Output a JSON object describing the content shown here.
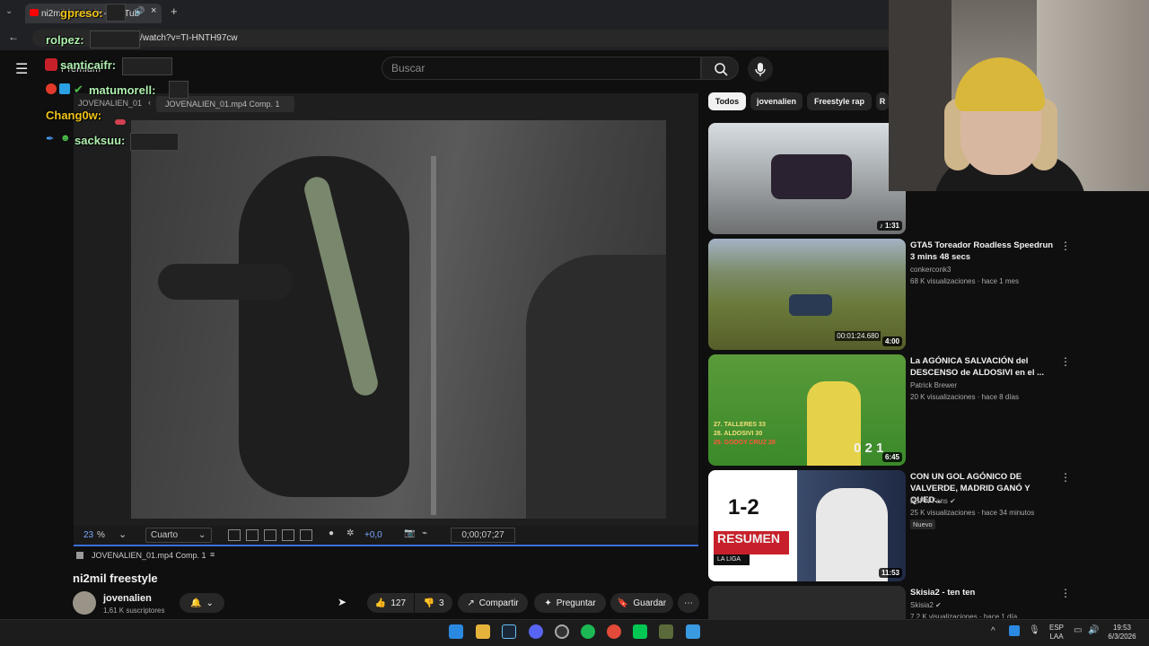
{
  "browser": {
    "tab_title": "ni2mil freestyle - YouTube",
    "url": "/watch?v=TI-HNTH97cw"
  },
  "youtube": {
    "premium_label": "Premium",
    "search_placeholder": "Buscar"
  },
  "editor": {
    "left_label": "JOVENALIEN_01",
    "tab_label": "JOVENALIEN_01.mp4 Comp. 1",
    "zoom": "23",
    "zoom_unit": "%",
    "resolution": "Cuarto",
    "exposure": "+0,0",
    "timecode": "0;00;07;27",
    "comp_label": "JOVENALIEN_01.mp4 Comp. 1"
  },
  "video": {
    "title": "ni2mil freestyle",
    "channel": "jovenalien",
    "subscribers": "1,61 K suscriptores",
    "likes": "127",
    "dislikes": "3",
    "share_label": "Compartir",
    "ask_label": "Preguntar",
    "save_label": "Guardar"
  },
  "chips": [
    "Todos",
    "jovenalien",
    "Freestyle rap",
    "R"
  ],
  "recommendations": [
    {
      "duration": "1:31",
      "title": "",
      "channel": "",
      "meta": ""
    },
    {
      "duration": "4:00",
      "overlay": "00:01:24.680",
      "title": "GTA5 Toreador Roadless Speedrun 3 mins 48 secs",
      "channel": "conkerconk3",
      "meta": "68 K visualizaciones · hace 1 mes"
    },
    {
      "duration": "6:45",
      "title": "La AGÓNICA SALVACIÓN del DESCENSO de ALDOSIVI en el ...",
      "channel": "Patrick Brewer",
      "meta": "20 K visualizaciones · hace 8 días",
      "overlay_lines": [
        "27. TALLERES 33",
        "28. ALDOSIVI 30",
        "29. GODOY CRUZ 28"
      ],
      "score": "0 2 1"
    },
    {
      "duration": "11:53",
      "title": "CON UN GOL AGÓNICO DE VALVERDE, MADRID GANÓ Y QUED...",
      "channel": "ESPN Fans",
      "meta": "25 K visualizaciones · hace 34 minutos",
      "badge": "Nuevo",
      "overlay_score": "1-2",
      "overlay_text": "RESUMEN",
      "overlay_sub": "LA LIGA"
    },
    {
      "duration": "",
      "title": "Skisia2 - ten ten",
      "channel": "Skisia2",
      "meta": "7,2 K visualizaciones · hace 1 día"
    }
  ],
  "chat": [
    {
      "user": "gpreso:",
      "color": "#f0c419"
    },
    {
      "user": "rolpez:",
      "color": "#b0f0b0"
    },
    {
      "user": "santicaifr:",
      "color": "#b0f0b0"
    },
    {
      "user": "matumorell:",
      "color": "#b0f0b0"
    },
    {
      "user": "Chang0w:",
      "color": "#f0c419"
    },
    {
      "user": "sacksuu:",
      "color": "#b0f0b0"
    }
  ],
  "taskbar": {
    "lang": "ESP",
    "lang2": "LAA",
    "time": "19:53",
    "date": "6/3/2026"
  },
  "colors": {
    "accent_blue": "#3a6fd8",
    "youtube_red": "#ff0000",
    "bg": "#0f0f0f"
  }
}
